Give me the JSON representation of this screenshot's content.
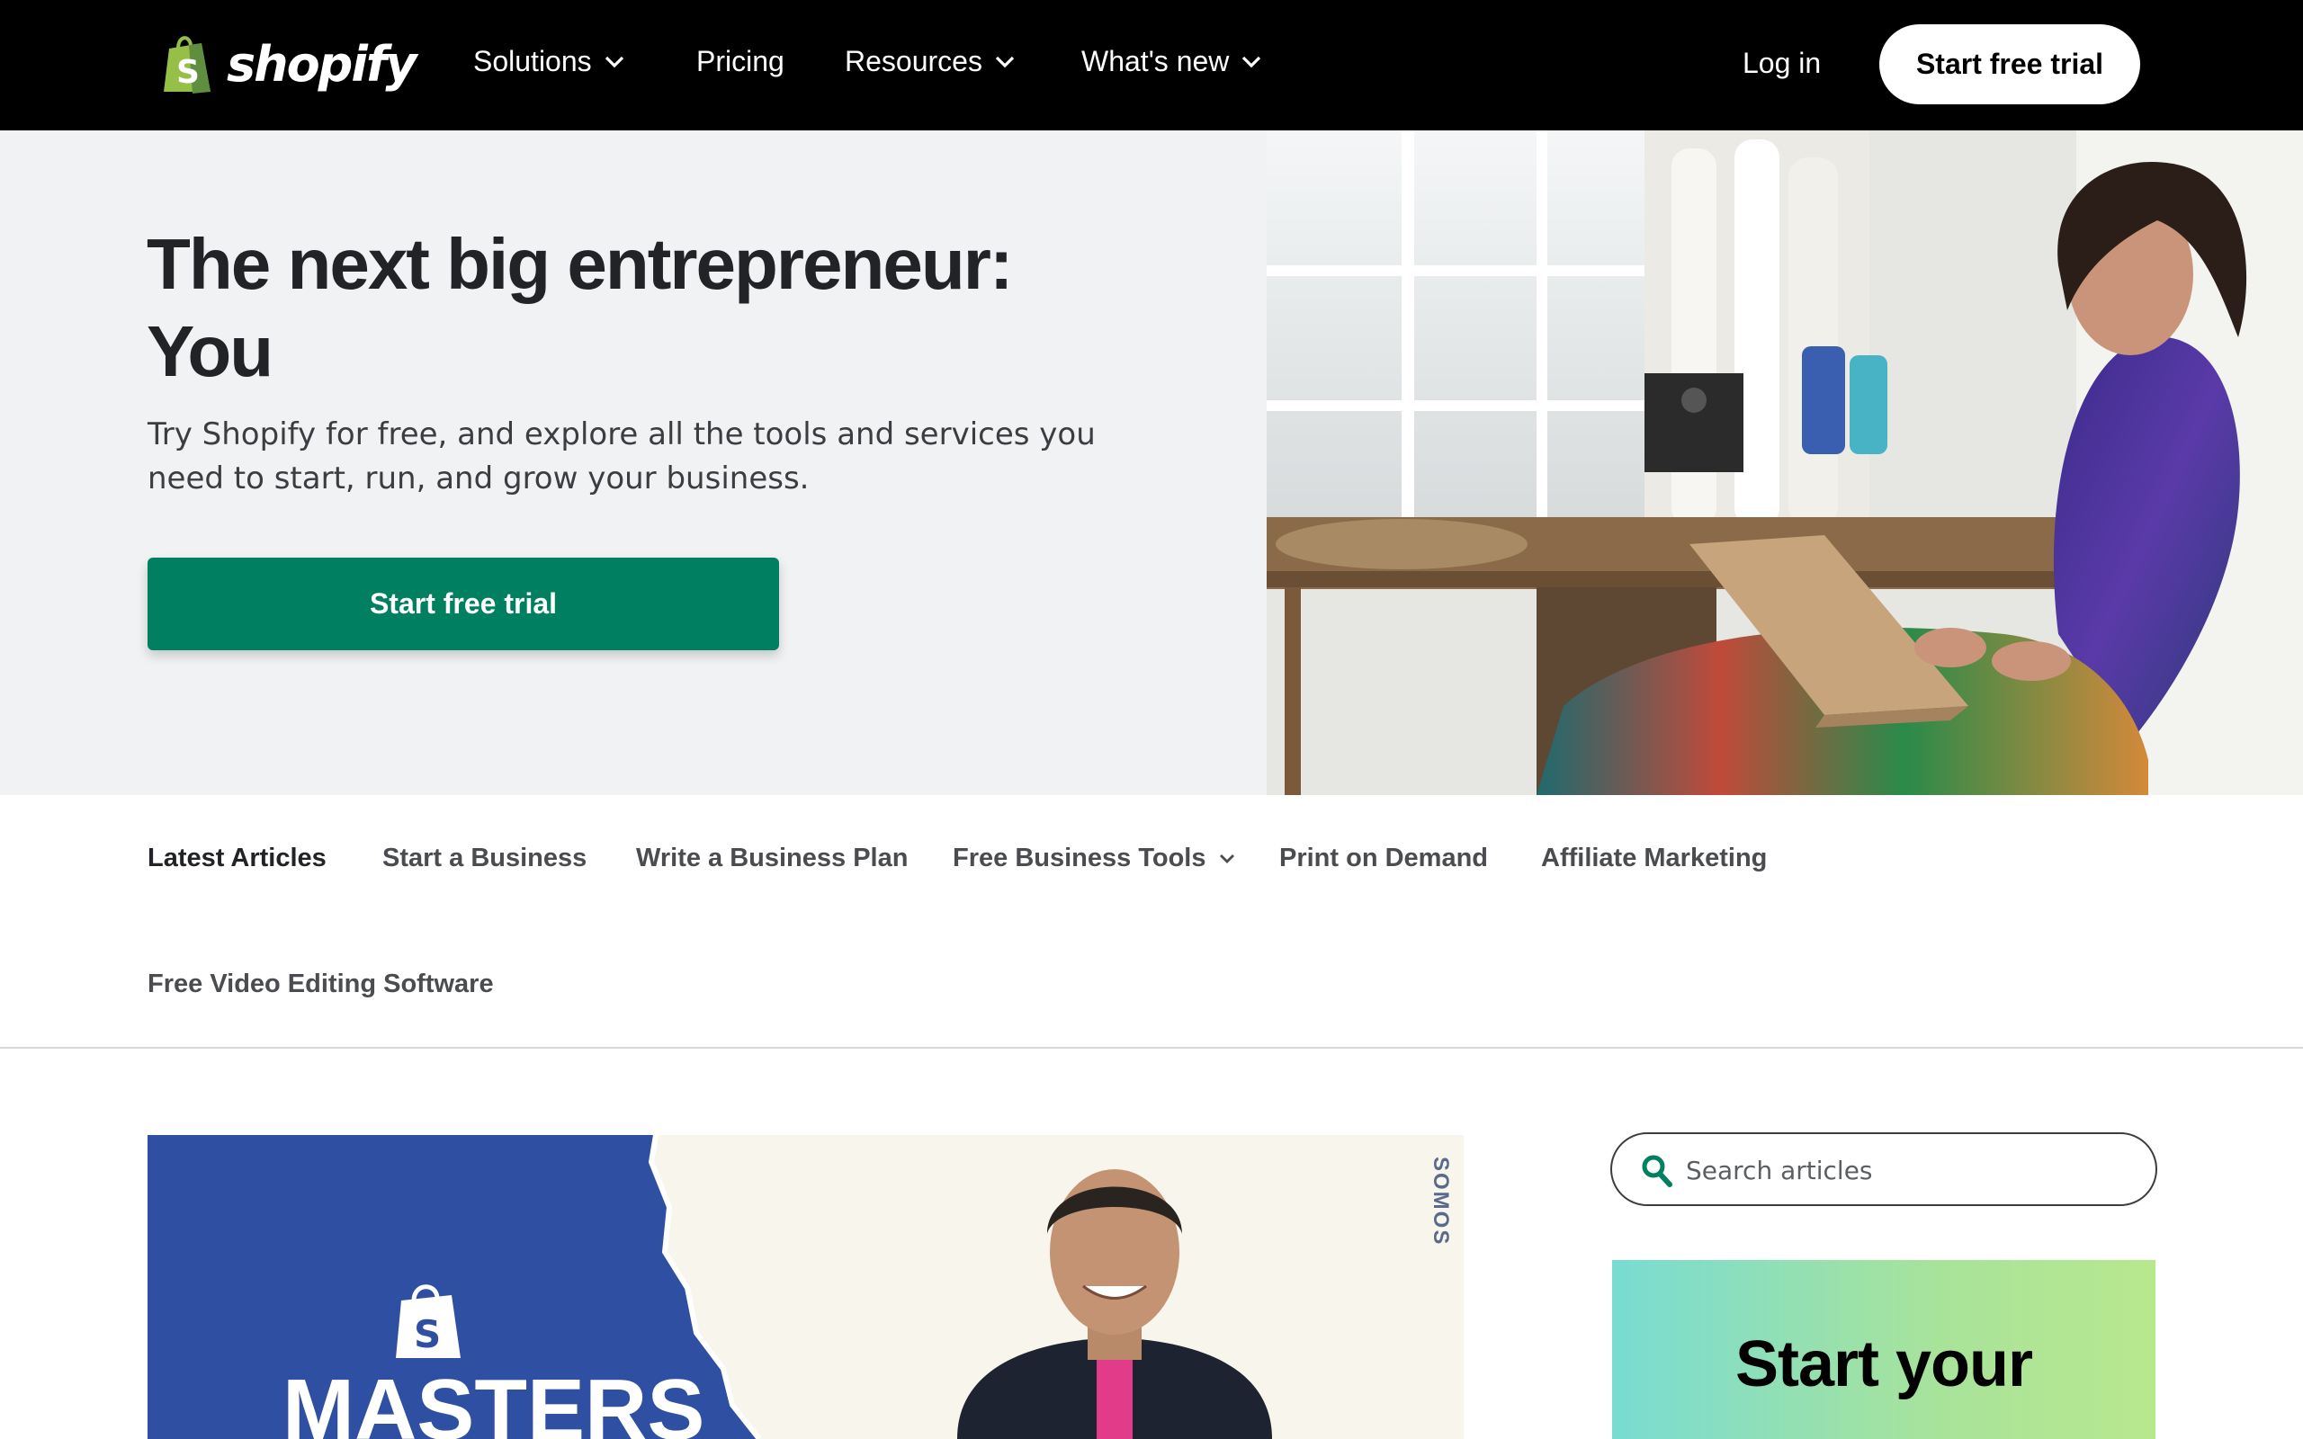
{
  "header": {
    "logo_text": "shopify",
    "logo_bag_letter": "S",
    "nav": [
      {
        "label": "Solutions",
        "has_dropdown": true
      },
      {
        "label": "Pricing",
        "has_dropdown": false
      },
      {
        "label": "Resources",
        "has_dropdown": true
      },
      {
        "label": "What's new",
        "has_dropdown": true
      }
    ],
    "login_label": "Log in",
    "trial_label": "Start free trial"
  },
  "hero": {
    "title_line1": "The next big entrepreneur:",
    "title_line2": "You",
    "subtitle": "Try Shopify for free, and explore all the tools and services you need to start, run, and grow your business.",
    "cta_label": "Start free trial"
  },
  "subnav": {
    "items": [
      {
        "label": "Latest Articles",
        "active": true
      },
      {
        "label": "Start a Business"
      },
      {
        "label": "Write a Business Plan"
      },
      {
        "label": "Free Business Tools",
        "has_dropdown": true
      },
      {
        "label": "Print on Demand"
      },
      {
        "label": "Affiliate Marketing"
      },
      {
        "label": "Free Video Editing Software"
      }
    ]
  },
  "feature": {
    "banner_text": "MASTERS",
    "side_text": "SOMOS",
    "badge_letter": "S"
  },
  "sidebar": {
    "search_placeholder": "Search articles",
    "promo_title": "Start your"
  },
  "colors": {
    "brand_green": "#008060",
    "logo_green": "#95bf47",
    "nav_bg": "#000000",
    "hero_bg": "#f1f2f4",
    "feature_blue": "#2f4fa2"
  }
}
